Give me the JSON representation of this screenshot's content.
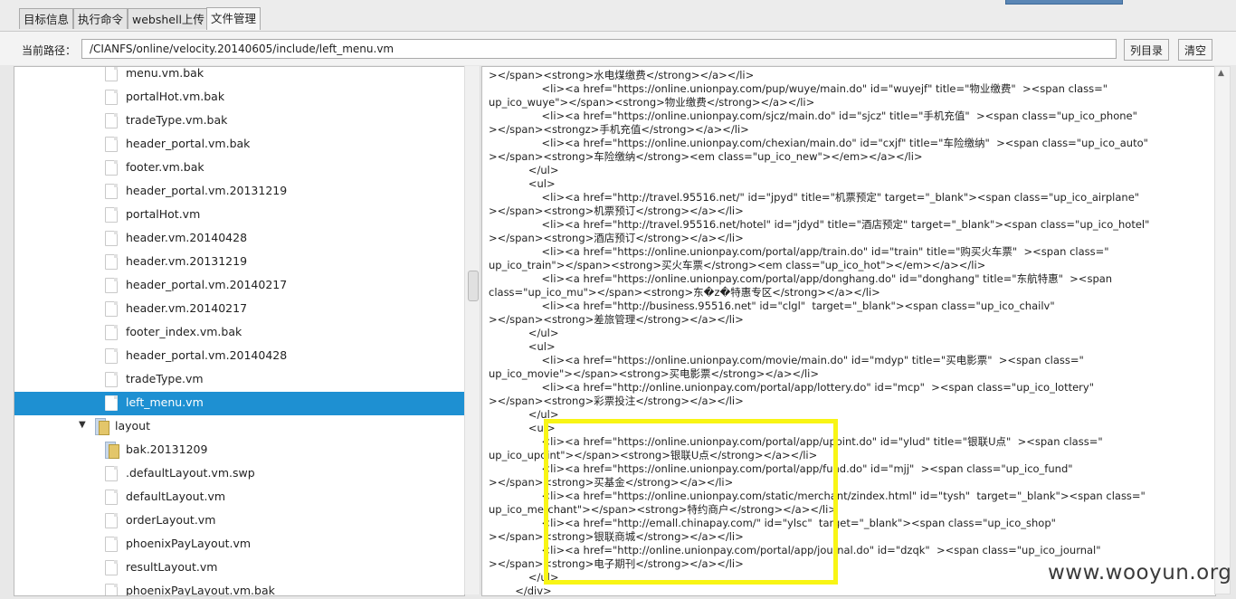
{
  "tabs": [
    "目标信息",
    "执行命令",
    "webshell上传",
    "文件管理"
  ],
  "path_bar": {
    "label": "当前路径：",
    "value": "/CIANFS/online/velocity.20140605/include/left_menu.vm",
    "list_button": "列目录",
    "clear_button": "清空"
  },
  "file_tree": [
    {
      "label": "menu.vm.bak",
      "type": "file"
    },
    {
      "label": "portalHot.vm.bak",
      "type": "file"
    },
    {
      "label": "tradeType.vm.bak",
      "type": "file"
    },
    {
      "label": "header_portal.vm.bak",
      "type": "file"
    },
    {
      "label": "footer.vm.bak",
      "type": "file"
    },
    {
      "label": "header_portal.vm.20131219",
      "type": "file"
    },
    {
      "label": "portalHot.vm",
      "type": "file"
    },
    {
      "label": "header.vm.20140428",
      "type": "file"
    },
    {
      "label": "header.vm.20131219",
      "type": "file"
    },
    {
      "label": "header_portal.vm.20140217",
      "type": "file"
    },
    {
      "label": "header.vm.20140217",
      "type": "file"
    },
    {
      "label": "footer_index.vm.bak",
      "type": "file"
    },
    {
      "label": "header_portal.vm.20140428",
      "type": "file"
    },
    {
      "label": "tradeType.vm",
      "type": "file"
    },
    {
      "label": "left_menu.vm",
      "type": "file",
      "selected": true
    },
    {
      "label": "layout",
      "type": "folder",
      "expanded": true
    },
    {
      "label": "bak.20131209",
      "type": "folder"
    },
    {
      "label": ".defaultLayout.vm.swp",
      "type": "file"
    },
    {
      "label": "defaultLayout.vm",
      "type": "file"
    },
    {
      "label": "orderLayout.vm",
      "type": "file"
    },
    {
      "label": "phoenixPayLayout.vm",
      "type": "file"
    },
    {
      "label": "resultLayout.vm",
      "type": "file"
    },
    {
      "label": "phoenixPayLayout.vm.bak",
      "type": "file"
    }
  ],
  "code_lines": [
    "></span><strong>水电煤缴费</strong></a></li>",
    "                <li><a href=\"https://online.unionpay.com/pup/wuye/main.do\" id=\"wuyejf\" title=\"物业缴费\"  ><span class=\"",
    "up_ico_wuye\"></span><strong>物业缴费</strong></a></li>",
    "                <li><a href=\"https://online.unionpay.com/sjcz/main.do\" id=\"sjcz\" title=\"手机充值\"  ><span class=\"up_ico_phone\"",
    "></span><strongz>手机充值</strong></a></li>",
    "                <li><a href=\"https://online.unionpay.com/chexian/main.do\" id=\"cxjf\" title=\"车险缴纳\"  ><span class=\"up_ico_auto\"",
    "></span><strong>车险缴纳</strong><em class=\"up_ico_new\"></em></a></li>",
    "            </ul>",
    "            <ul>",
    "                <li><a href=\"http://travel.95516.net/\" id=\"jpyd\" title=\"机票预定\" target=\"_blank\"><span class=\"up_ico_airplane\"",
    "></span><strong>机票预订</strong></a></li>",
    "                <li><a href=\"http://travel.95516.net/hotel\" id=\"jdyd\" title=\"酒店预定\" target=\"_blank\"><span class=\"up_ico_hotel\"",
    "></span><strong>酒店预订</strong></a></li>",
    "                <li><a href=\"https://online.unionpay.com/portal/app/train.do\" id=\"train\" title=\"购买火车票\"  ><span class=\"",
    "up_ico_train\"></span><strong>买火车票</strong><em class=\"up_ico_hot\"></em></a></li>",
    "                <li><a href=\"https://online.unionpay.com/portal/app/donghang.do\" id=\"donghang\" title=\"东航特惠\"  ><span",
    "class=\"up_ico_mu\"></span><strong>东�z�特惠专区</strong></a></li>",
    "                <li><a href=\"http://business.95516.net\" id=\"clgl\"  target=\"_blank\"><span class=\"up_ico_chailv\"",
    "></span><strong>差旅管理</strong></a></li>",
    "            </ul>",
    "            <ul>",
    "                <li><a href=\"https://online.unionpay.com/movie/main.do\" id=\"mdyp\" title=\"买电影票\"  ><span class=\"",
    "up_ico_movie\"></span><strong>买电影票</strong></a></li>",
    "                <li><a href=\"http://online.unionpay.com/portal/app/lottery.do\" id=\"mcp\"  ><span class=\"up_ico_lottery\"",
    "></span><strong>彩票投注</strong></a></li>",
    "            </ul>",
    "            <ul>",
    "                <li><a href=\"https://online.unionpay.com/portal/app/upoint.do\" id=\"ylud\" title=\"银联U点\"  ><span class=\"",
    "up_ico_upoint\"></span><strong>银联U点</strong></a></li>",
    "                <li><a href=\"https://online.unionpay.com/portal/app/fund.do\" id=\"mjj\"  ><span class=\"up_ico_fund\"",
    "></span><strong>买基金</strong></a></li>",
    "                <li><a href=\"https://online.unionpay.com/static/merchant/zindex.html\" id=\"tysh\"  target=\"_blank\"><span class=\"",
    "up_ico_merchant\"></span><strong>特约商户</strong></a></li>",
    "                <li><a href=\"http://emall.chinapay.com/\" id=\"ylsc\"  target=\"_blank\"><span class=\"up_ico_shop\"",
    "></span><strong>银联商城</strong></a></li>",
    "                <li><a href=\"http://online.unionpay.com/portal/app/journal.do\" id=\"dzqk\"  ><span class=\"up_ico_journal\"",
    "></span><strong>电子期刊</strong></a></li>",
    "            </ul>",
    "        </div>"
  ],
  "watermark": "www.wooyun.org",
  "colors": {
    "selection": "#1e90d2",
    "highlight_box": "#f8f515"
  }
}
